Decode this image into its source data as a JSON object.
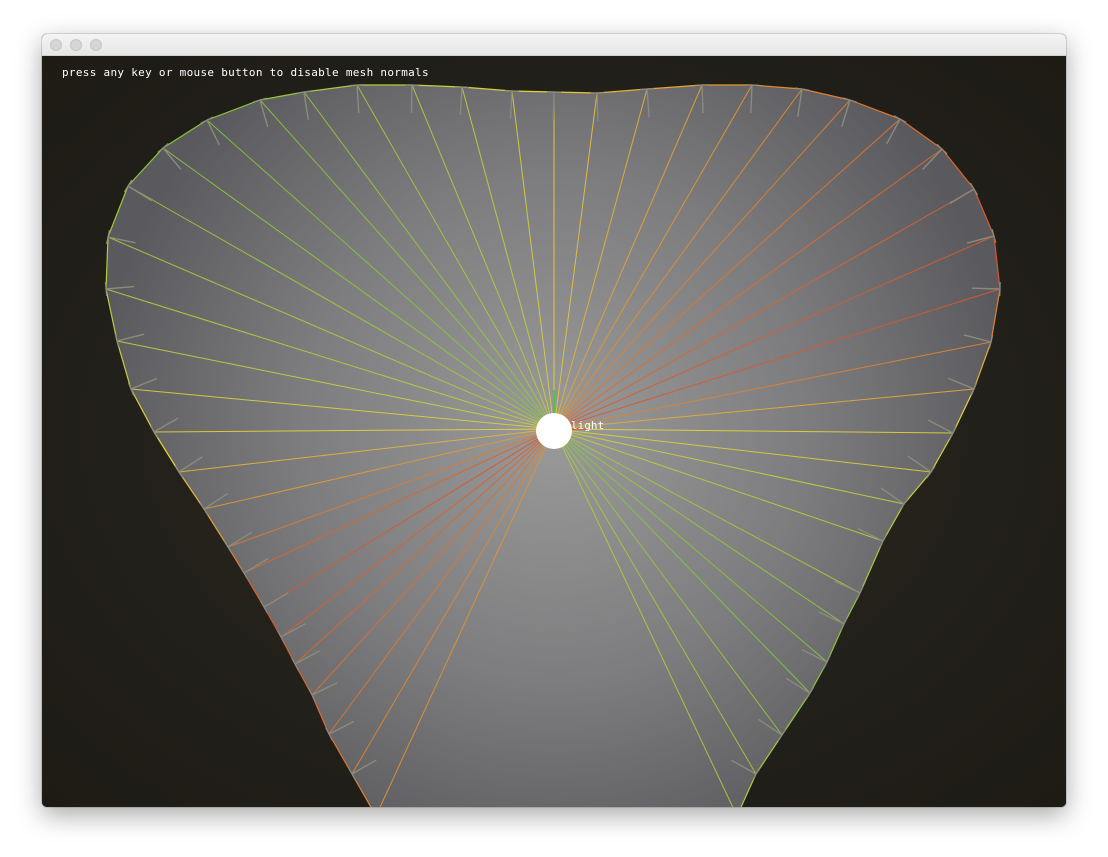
{
  "window": {
    "title": "",
    "buttons": [
      "close",
      "minimize",
      "zoom"
    ]
  },
  "canvas": {
    "background_color": "#1f1d13",
    "hint_text": "press any key or mouse button to disable mesh normals",
    "light_label": "light",
    "colors": {
      "green": "#7ec63a",
      "yellow": "#e8d23a",
      "orange": "#e0782a",
      "red": "#d8542a",
      "normal_gray": "#8a8a7e",
      "light_ball": "#ffffff",
      "light_axis": "#56c04a"
    }
  },
  "mesh": {
    "type": "heart-shaped triangle fan",
    "show_normals": true
  }
}
